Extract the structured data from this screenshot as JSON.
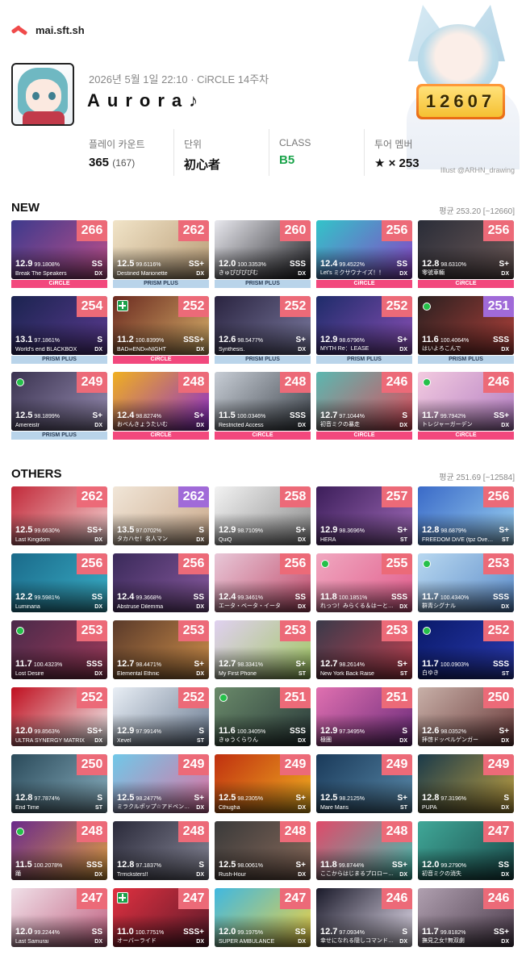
{
  "brand": {
    "name": "mai.sft.sh"
  },
  "profile": {
    "date": "2026년 5월 1일 22:10 · CiRCLE 14주차",
    "name": "Aurora♪",
    "rating": "12607"
  },
  "stats": [
    {
      "label": "플레이 카운트",
      "value": "365",
      "sub": "(167)"
    },
    {
      "label": "단위",
      "value": "初心者",
      "sub": ""
    },
    {
      "label": "CLASS",
      "value": "B5",
      "sub": ""
    },
    {
      "label": "투어 멤버",
      "value": "★ × 253",
      "sub": ""
    }
  ],
  "illust": {
    "credit": "Illust @ARHN_drawing"
  },
  "colors": {
    "badge": "#ec6a78",
    "badge_alt": "#a06ad8",
    "circle": "#f2487d",
    "prism": "#b9d4ea",
    "green": "#1aa34a",
    "rating": "#f5c032"
  },
  "new_section": {
    "title": "NEW",
    "average": "평균 253.20 [~12660]",
    "cards": [
      {
        "rating": "266",
        "level": "12.9",
        "acc": "99.1808%",
        "rank": "SS",
        "title": "Break The Speakers",
        "type": "DX",
        "ver": "CiRCLE",
        "mark": "",
        "bg": "#3d3a8c,#c14f8a"
      },
      {
        "rating": "262",
        "level": "12.5",
        "acc": "99.6116%",
        "rank": "SS+",
        "title": "Destined Marionette",
        "type": "DX",
        "ver": "PRISM PLUS",
        "mark": "",
        "bg": "#f1e4c8,#b79a74"
      },
      {
        "rating": "260",
        "level": "12.0",
        "acc": "100.3353%",
        "rank": "SSS",
        "title": "きゅぴぴぴぴむ",
        "type": "DX",
        "ver": "PRISM PLUS",
        "mark": "",
        "bg": "#e8e8ee,#202024"
      },
      {
        "rating": "256",
        "level": "12.4",
        "acc": "99.4522%",
        "rank": "SS",
        "title": "Let's ミクサウナイズ！！",
        "type": "DX",
        "ver": "CiRCLE",
        "mark": "",
        "bg": "#32c4c9,#8c3fc5"
      },
      {
        "rating": "256",
        "level": "12.8",
        "acc": "98.6310%",
        "rank": "S+",
        "title": "零號車輛",
        "type": "DX",
        "ver": "CiRCLE",
        "mark": "",
        "bg": "#2a2d38,#6e5a58"
      },
      {
        "rating": "254",
        "level": "13.1",
        "acc": "97.1861%",
        "rank": "S",
        "title": "World's end BLACKBOX",
        "type": "DX",
        "ver": "PRISM PLUS",
        "mark": "",
        "bg": "#1b2450,#5b3a90"
      },
      {
        "rating": "252",
        "level": "11.2",
        "acc": "100.8399%",
        "rank": "SSS+",
        "title": "BAD∞END∞NIGHT",
        "type": "DX",
        "ver": "CiRCLE",
        "mark": "plus",
        "bg": "#6b2a20,#d7b06a"
      },
      {
        "rating": "252",
        "level": "12.6",
        "acc": "98.5477%",
        "rank": "S+",
        "title": "Synthesis.",
        "type": "DX",
        "ver": "PRISM PLUS",
        "mark": "",
        "bg": "#2a2440,#7b7aa0"
      },
      {
        "rating": "252",
        "level": "12.9",
        "acc": "98.6796%",
        "rank": "S+",
        "title": "MYTH Re：LEASE",
        "type": "DX",
        "ver": "PRISM PLUS",
        "mark": "",
        "bg": "#1e2c6a,#8a4fb5"
      },
      {
        "rating": "251",
        "level": "11.6",
        "acc": "100.4064%",
        "rank": "SSS",
        "title": "はいよろこんで",
        "type": "DX",
        "ver": "PRISM PLUS",
        "mark": "fc",
        "badge": "purple",
        "bg": "#2a2020,#b0403a"
      },
      {
        "rating": "249",
        "level": "12.5",
        "acc": "98.1899%",
        "rank": "S+",
        "title": "Amereistr",
        "type": "DX",
        "ver": "PRISM PLUS",
        "mark": "fc",
        "bg": "#3a3350,#9a8fb5"
      },
      {
        "rating": "248",
        "level": "12.4",
        "acc": "98.8274%",
        "rank": "S+",
        "title": "おべんきょうたいむ",
        "type": "DX",
        "ver": "CiRCLE",
        "mark": "",
        "bg": "#f0b020,#8a2ad0"
      },
      {
        "rating": "248",
        "level": "11.5",
        "acc": "100.0346%",
        "rank": "SSS",
        "title": "Restricted Access",
        "type": "DX",
        "ver": "CiRCLE",
        "mark": "",
        "bg": "#c8ced6,#3a4048"
      },
      {
        "rating": "246",
        "level": "12.7",
        "acc": "97.1044%",
        "rank": "S",
        "title": "初音ミクの暴走",
        "type": "DX",
        "ver": "CiRCLE",
        "mark": "",
        "bg": "#5ab8b0,#e04a5a"
      },
      {
        "rating": "246",
        "level": "11.7",
        "acc": "99.7942%",
        "rank": "SS+",
        "title": "トレジャーガーデン",
        "type": "DX",
        "ver": "CiRCLE",
        "mark": "fc",
        "bg": "#f3cbe0,#b07ac0"
      }
    ]
  },
  "others_section": {
    "title": "OTHERS",
    "average": "평균 251.69 [~12584]",
    "cards": [
      {
        "rating": "262",
        "level": "12.5",
        "acc": "99.6630%",
        "rank": "SS+",
        "title": "Last Kingdom",
        "type": "DX",
        "mark": "",
        "bg": "#c22a3a,#f3d0d0"
      },
      {
        "rating": "262",
        "level": "13.5",
        "acc": "97.0702%",
        "rank": "S",
        "title": "タカハセ！名人マン",
        "type": "DX",
        "mark": "",
        "badge": "purple",
        "bg": "#f1e6d8,#c9a88a"
      },
      {
        "rating": "258",
        "level": "12.9",
        "acc": "98.7109%",
        "rank": "S+",
        "title": "QuiQ",
        "type": "DX",
        "mark": "",
        "bg": "#f3f3f3,#8a8a8a"
      },
      {
        "rating": "257",
        "level": "12.9",
        "acc": "98.3696%",
        "rank": "S+",
        "title": "HERA",
        "type": "ST",
        "mark": "",
        "bg": "#3c1e5a,#a06ab8"
      },
      {
        "rating": "256",
        "level": "12.8",
        "acc": "98.6879%",
        "rank": "S+",
        "title": "FREEDOM DiVE (tpz Ove…",
        "type": "ST",
        "mark": "",
        "bg": "#3a6ac8,#9ad0f0"
      },
      {
        "rating": "256",
        "level": "12.2",
        "acc": "99.5981%",
        "rank": "SS",
        "title": "Luminaria",
        "type": "DX",
        "mark": "",
        "bg": "#1a6a8a,#3ab0c8"
      },
      {
        "rating": "256",
        "level": "12.4",
        "acc": "99.3668%",
        "rank": "SS",
        "title": "Abstruse Dilemma",
        "type": "DX",
        "mark": "",
        "bg": "#3a2a5a,#8a5aa0"
      },
      {
        "rating": "256",
        "level": "12.4",
        "acc": "99.3461%",
        "rank": "SS",
        "title": "エータ・ベータ・イータ",
        "type": "DX",
        "mark": "",
        "bg": "#e8c8d8,#c04a6a"
      },
      {
        "rating": "255",
        "level": "11.8",
        "acc": "100.1851%",
        "rank": "SSS",
        "title": "れっつ！みらくる＆はーと…",
        "type": "DX",
        "mark": "fc",
        "bg": "#f0a8c0,#e05a8a"
      },
      {
        "rating": "253",
        "level": "11.7",
        "acc": "100.4340%",
        "rank": "SSS",
        "title": "群青シグナル",
        "type": "DX",
        "mark": "fc",
        "bg": "#b8d8f0,#5a8ac8"
      },
      {
        "rating": "253",
        "level": "11.7",
        "acc": "100.4323%",
        "rank": "SSS",
        "title": "Lost Desire",
        "type": "DX",
        "mark": "fc",
        "bg": "#4a2a4a,#a03a5a"
      },
      {
        "rating": "253",
        "level": "12.7",
        "acc": "98.4471%",
        "rank": "S+",
        "title": "Elemental Ethnic",
        "type": "DX",
        "mark": "",
        "bg": "#5a3a2a,#d0904a"
      },
      {
        "rating": "253",
        "level": "12.7",
        "acc": "98.3341%",
        "rank": "S+",
        "title": "My First Phone",
        "type": "ST",
        "mark": "",
        "bg": "#e0d0f0,#a0c860"
      },
      {
        "rating": "253",
        "level": "12.7",
        "acc": "98.2614%",
        "rank": "S+",
        "title": "New York Back Raise",
        "type": "ST",
        "mark": "",
        "bg": "#3a3a4a,#c04050"
      },
      {
        "rating": "252",
        "level": "11.7",
        "acc": "100.0903%",
        "rank": "SSS",
        "title": "白ゆき",
        "type": "ST",
        "mark": "fc",
        "bg": "#0a1a6a,#2a3ab0"
      },
      {
        "rating": "252",
        "level": "12.0",
        "acc": "99.8563%",
        "rank": "SS+",
        "title": "ULTRA SYNERGY MATRIX",
        "type": "DX",
        "mark": "",
        "bg": "#c01020,#f0f0f0"
      },
      {
        "rating": "252",
        "level": "12.9",
        "acc": "97.9914%",
        "rank": "S",
        "title": "Xevel",
        "type": "ST",
        "mark": "",
        "bg": "#e8eef5,#6a7a90"
      },
      {
        "rating": "251",
        "level": "11.6",
        "acc": "100.3405%",
        "rank": "SSS",
        "title": "きゅうくらりん",
        "type": "DX",
        "mark": "fc",
        "bg": "#6a8a6a,#2a3a3a"
      },
      {
        "rating": "251",
        "level": "12.9",
        "acc": "97.3495%",
        "rank": "S",
        "title": "極圏",
        "type": "DX",
        "mark": "",
        "bg": "#e070b0,#6a2a7a"
      },
      {
        "rating": "250",
        "level": "12.6",
        "acc": "98.0352%",
        "rank": "S+",
        "title": "拝啓ドッペルゲンガー",
        "type": "DX",
        "mark": "",
        "bg": "#c8b0a8,#6a3a3a"
      },
      {
        "rating": "250",
        "level": "12.8",
        "acc": "97.7874%",
        "rank": "S",
        "title": "End Time",
        "type": "ST",
        "mark": "",
        "bg": "#2a4a5a,#8ab0c0"
      },
      {
        "rating": "249",
        "level": "12.5",
        "acc": "98.2477%",
        "rank": "S+",
        "title": "ミラクルポップ☆アドベン…",
        "type": "DX",
        "mark": "",
        "bg": "#70c8e8,#e070a0"
      },
      {
        "rating": "249",
        "level": "12.5",
        "acc": "98.2305%",
        "rank": "S+",
        "title": "Cthugha",
        "type": "DX",
        "mark": "",
        "bg": "#c03010,#f0b020"
      },
      {
        "rating": "249",
        "level": "12.5",
        "acc": "98.2125%",
        "rank": "S+",
        "title": "Mare Maris",
        "type": "ST",
        "mark": "",
        "bg": "#1a3a5a,#5a8aaa"
      },
      {
        "rating": "249",
        "level": "12.8",
        "acc": "97.3196%",
        "rank": "S",
        "title": "PUPA",
        "type": "DX",
        "mark": "",
        "bg": "#1a3a4a,#c0a040"
      },
      {
        "rating": "248",
        "level": "11.5",
        "acc": "100.2078%",
        "rank": "SSS",
        "title": "踊",
        "type": "DX",
        "mark": "fc",
        "bg": "#6a2a8a,#e0a040"
      },
      {
        "rating": "248",
        "level": "12.8",
        "acc": "97.1837%",
        "rank": "S",
        "title": "Trrricksters!!",
        "type": "DX",
        "mark": "",
        "bg": "#2a2a3a,#8a8a9a"
      },
      {
        "rating": "248",
        "level": "12.5",
        "acc": "98.0061%",
        "rank": "S+",
        "title": "Rush-Hour",
        "type": "DX",
        "mark": "",
        "bg": "#3a3a3a,#8a6a5a"
      },
      {
        "rating": "248",
        "level": "11.8",
        "acc": "99.8744%",
        "rank": "SS+",
        "title": "ここからはじまるプロロー…",
        "type": "DX",
        "mark": "",
        "bg": "#e04a6a,#40c0b0"
      },
      {
        "rating": "247",
        "level": "12.0",
        "acc": "99.2790%",
        "rank": "SS",
        "title": "初音ミクの消失",
        "type": "DX",
        "mark": "",
        "bg": "#40a898,#1a4a4a"
      },
      {
        "rating": "247",
        "level": "12.0",
        "acc": "99.2244%",
        "rank": "SS",
        "title": "Last Samurai",
        "type": "DX",
        "mark": "",
        "bg": "#f0e0e8,#c06080"
      },
      {
        "rating": "247",
        "level": "11.0",
        "acc": "100.7751%",
        "rank": "SSS+",
        "title": "オーバーライド",
        "type": "DX",
        "mark": "plus",
        "bg": "#e03040,#5a1a2a"
      },
      {
        "rating": "247",
        "level": "12.0",
        "acc": "99.1975%",
        "rank": "SS",
        "title": "SUPER AMBULANCE",
        "type": "DX",
        "mark": "",
        "bg": "#40b8e0,#f0d040"
      },
      {
        "rating": "246",
        "level": "12.7",
        "acc": "97.0934%",
        "rank": "S",
        "title": "幸せになれる隠しコマンド…",
        "type": "DX",
        "mark": "",
        "bg": "#1a1a2a,#e8e0f0"
      },
      {
        "rating": "246",
        "level": "11.7",
        "acc": "99.8182%",
        "rank": "SS+",
        "title": "撫見之女†無双劇",
        "type": "DX",
        "mark": "",
        "bg": "#b0a0b0,#4a3a4a"
      }
    ]
  }
}
